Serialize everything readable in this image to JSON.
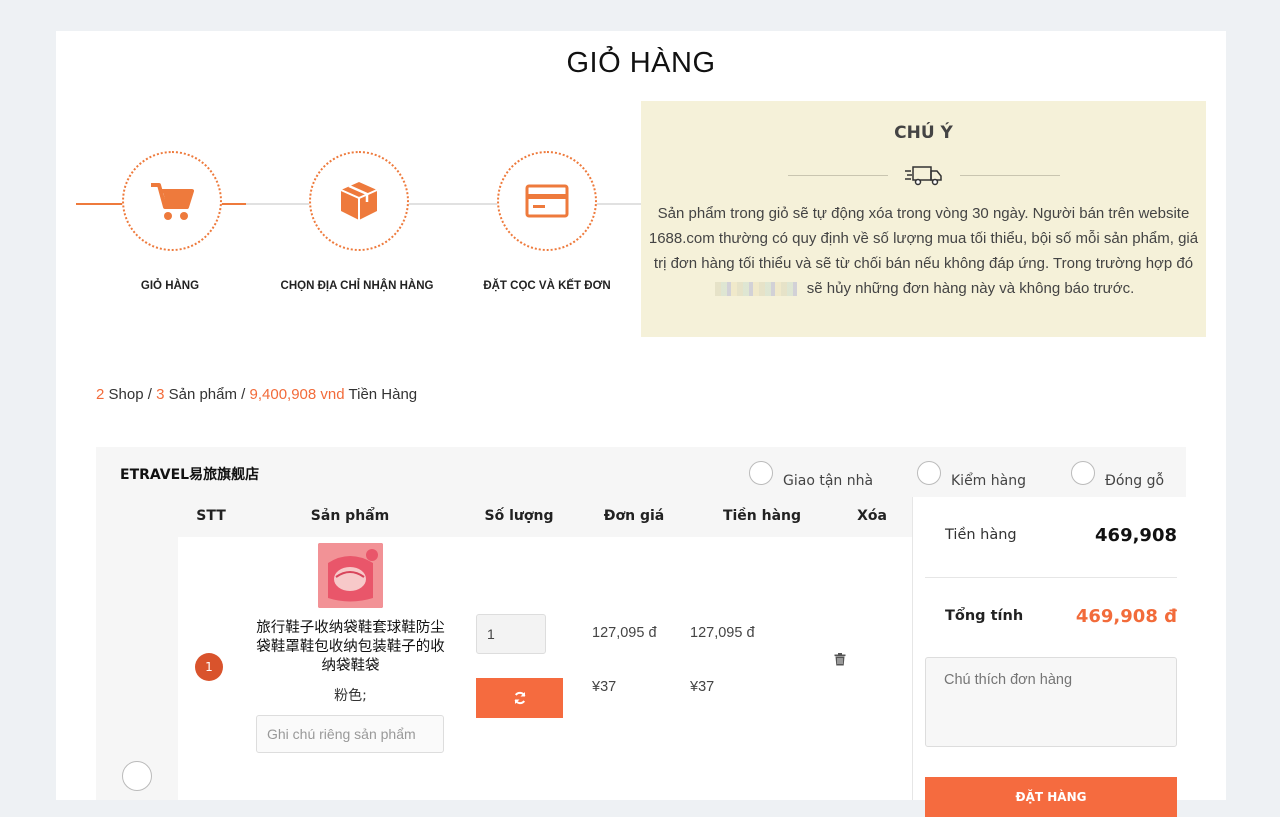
{
  "page": {
    "title": "GIỎ HÀNG"
  },
  "steps": [
    {
      "label": "GIỎ HÀNG",
      "icon": "cart-icon"
    },
    {
      "label": "CHỌN ĐỊA CHỈ NHẬN HÀNG",
      "icon": "box-icon"
    },
    {
      "label": "ĐẶT CỌC VÀ KẾT ĐƠN",
      "icon": "credit-card-icon"
    }
  ],
  "notice": {
    "title": "CHÚ Ý",
    "text_part1": "Sản phẩm trong giỏ sẽ tự động xóa trong vòng 30 ngày. Người bán trên website 1688.com thường có quy định về số lượng mua tối thiểu, bội số mỗi sản phẩm, giá trị đơn hàng tối thiểu và sẽ từ chối bán nếu không đáp ứng. Trong trường hợp đó",
    "text_part2": "sẽ hủy những đơn hàng này và không báo trước."
  },
  "summary": {
    "shop_count": "2",
    "shop_label": "Shop",
    "product_count": "3",
    "product_label": "Sản phẩm",
    "total": "9,400,908 vnd",
    "total_label": "Tiền Hàng",
    "sep": "/"
  },
  "shop": {
    "name": "ETRAVEL易旅旗舰店",
    "options": [
      "Giao tận nhà",
      "Kiểm hàng",
      "Đóng gỗ"
    ],
    "columns": [
      "STT",
      "Sản phẩm",
      "Số lượng",
      "Đơn giá",
      "Tiền hàng",
      "Xóa"
    ],
    "items": [
      {
        "index": "1",
        "name": "旅行鞋子收纳袋鞋套球鞋防尘袋鞋罩鞋包收纳包装鞋子的收纳袋鞋袋",
        "attribute": "粉色;",
        "note_placeholder": "Ghi chú riêng sản phẩm",
        "quantity": "1",
        "unit_price_vnd": "127,095 đ",
        "unit_price_cny": "¥37",
        "total_vnd": "127,095 đ",
        "total_cny": "¥37"
      }
    ]
  },
  "order_summary": {
    "subtotal_label": "Tiền hàng",
    "subtotal_value": "469,908",
    "total_label": "Tổng tính",
    "total_value": "469,908 đ",
    "note_placeholder": "Chú thích đơn hàng",
    "submit_label": "ĐẶT HÀNG"
  },
  "colors": {
    "accent": "#f56b3f",
    "notice_bg": "#f5f1d9",
    "badge": "#d9532c"
  }
}
